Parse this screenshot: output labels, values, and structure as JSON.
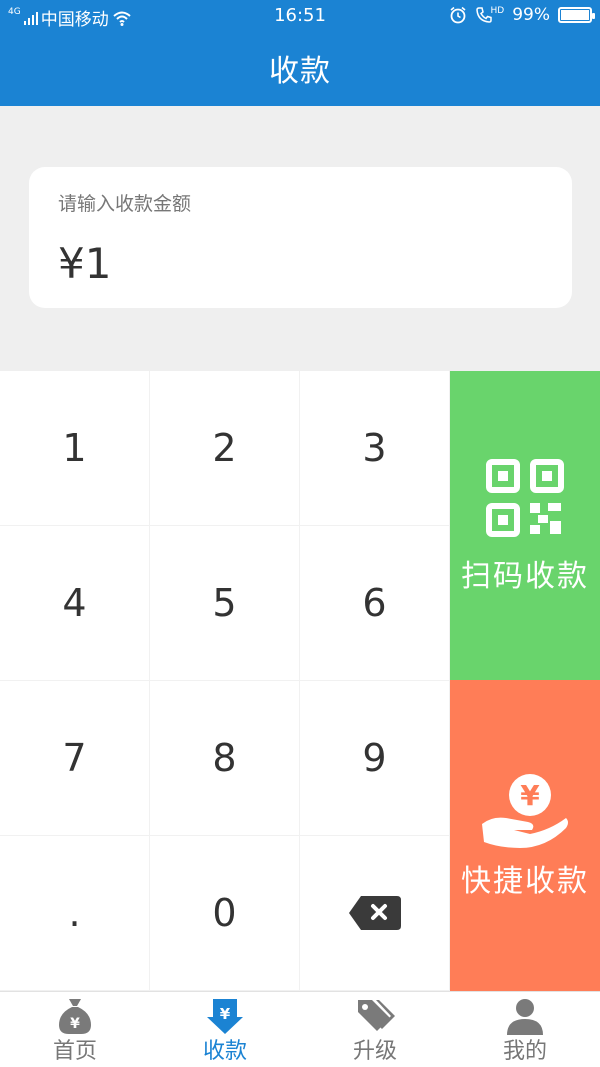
{
  "status_bar": {
    "network": "4G",
    "carrier": "中国移动",
    "time": "16:51",
    "call_type": "HD",
    "battery": "99%",
    "battery_level": 0.99
  },
  "header": {
    "title": "收款"
  },
  "amount": {
    "label": "请输入收款金额",
    "value": "¥1"
  },
  "keypad": {
    "keys": [
      "1",
      "2",
      "3",
      "4",
      "5",
      "6",
      "7",
      "8",
      "9",
      ".",
      "0"
    ],
    "delete_icon": "backspace-icon"
  },
  "actions": {
    "scan": {
      "label": "扫码收款",
      "icon": "qr-code-icon",
      "color": "#69d46c"
    },
    "quick": {
      "label": "快捷收款",
      "icon": "hand-yuan-icon",
      "color": "#ff7d57"
    }
  },
  "tabs": [
    {
      "label": "首页",
      "icon": "money-bag-icon"
    },
    {
      "label": "收款",
      "icon": "yuan-down-arrow-icon",
      "active": true
    },
    {
      "label": "升级",
      "icon": "tags-icon"
    },
    {
      "label": "我的",
      "icon": "user-icon"
    }
  ],
  "colors": {
    "primary": "#1b83d3",
    "background": "#efefef",
    "tab_inactive": "#777777"
  }
}
